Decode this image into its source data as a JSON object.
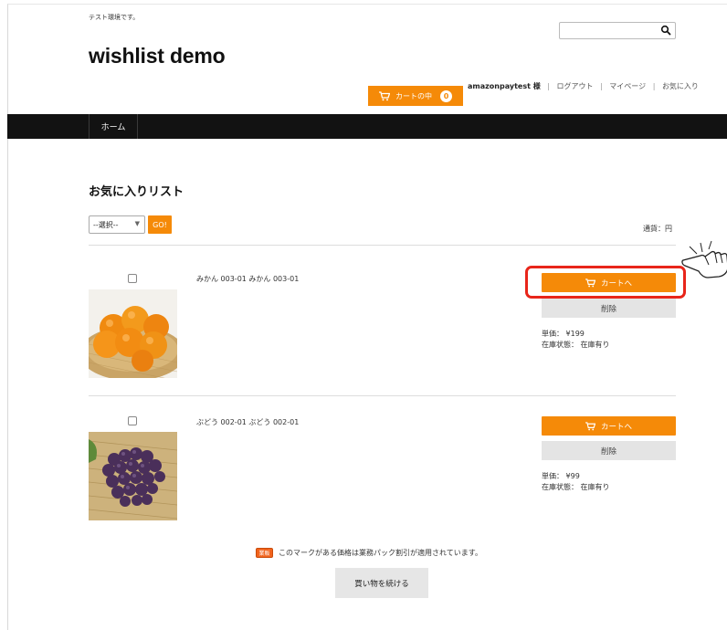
{
  "header": {
    "test_note": "テスト環境です。",
    "site_title": "wishlist demo",
    "search_placeholder": ""
  },
  "cart": {
    "label": "カートの中",
    "count": "0"
  },
  "user_nav": {
    "username": "amazonpaytest 様",
    "links": [
      "ログアウト",
      "マイページ",
      "お気に入り"
    ]
  },
  "nav": {
    "items": [
      "ホーム"
    ]
  },
  "main": {
    "title": "お気に入りリスト",
    "select_value": "--選択--",
    "go_label": "GO!",
    "currency": "通貨：円"
  },
  "items": [
    {
      "name": "みかん 003-01 みかん 003-01",
      "add_to_cart": "カートへ",
      "delete": "削除",
      "price": "単価： ¥199",
      "stock": "在庫状態： 在庫有り",
      "image_icon": "mandarin-oranges-photo"
    },
    {
      "name": "ぶどう 002-01 ぶどう 002-01",
      "add_to_cart": "カートへ",
      "delete": "削除",
      "price": "単価： ¥99",
      "stock": "在庫状態： 在庫有り",
      "image_icon": "grapes-photo"
    }
  ],
  "footer_note": {
    "badge": "業販",
    "text": "このマークがある価格は業務パック割引が適用されています。"
  },
  "continue_label": "買い物を続ける",
  "colors": {
    "accent": "#f58a08",
    "nav_bg": "#121212",
    "highlight": "#e8251a",
    "button_gray": "#e4e4e4"
  }
}
